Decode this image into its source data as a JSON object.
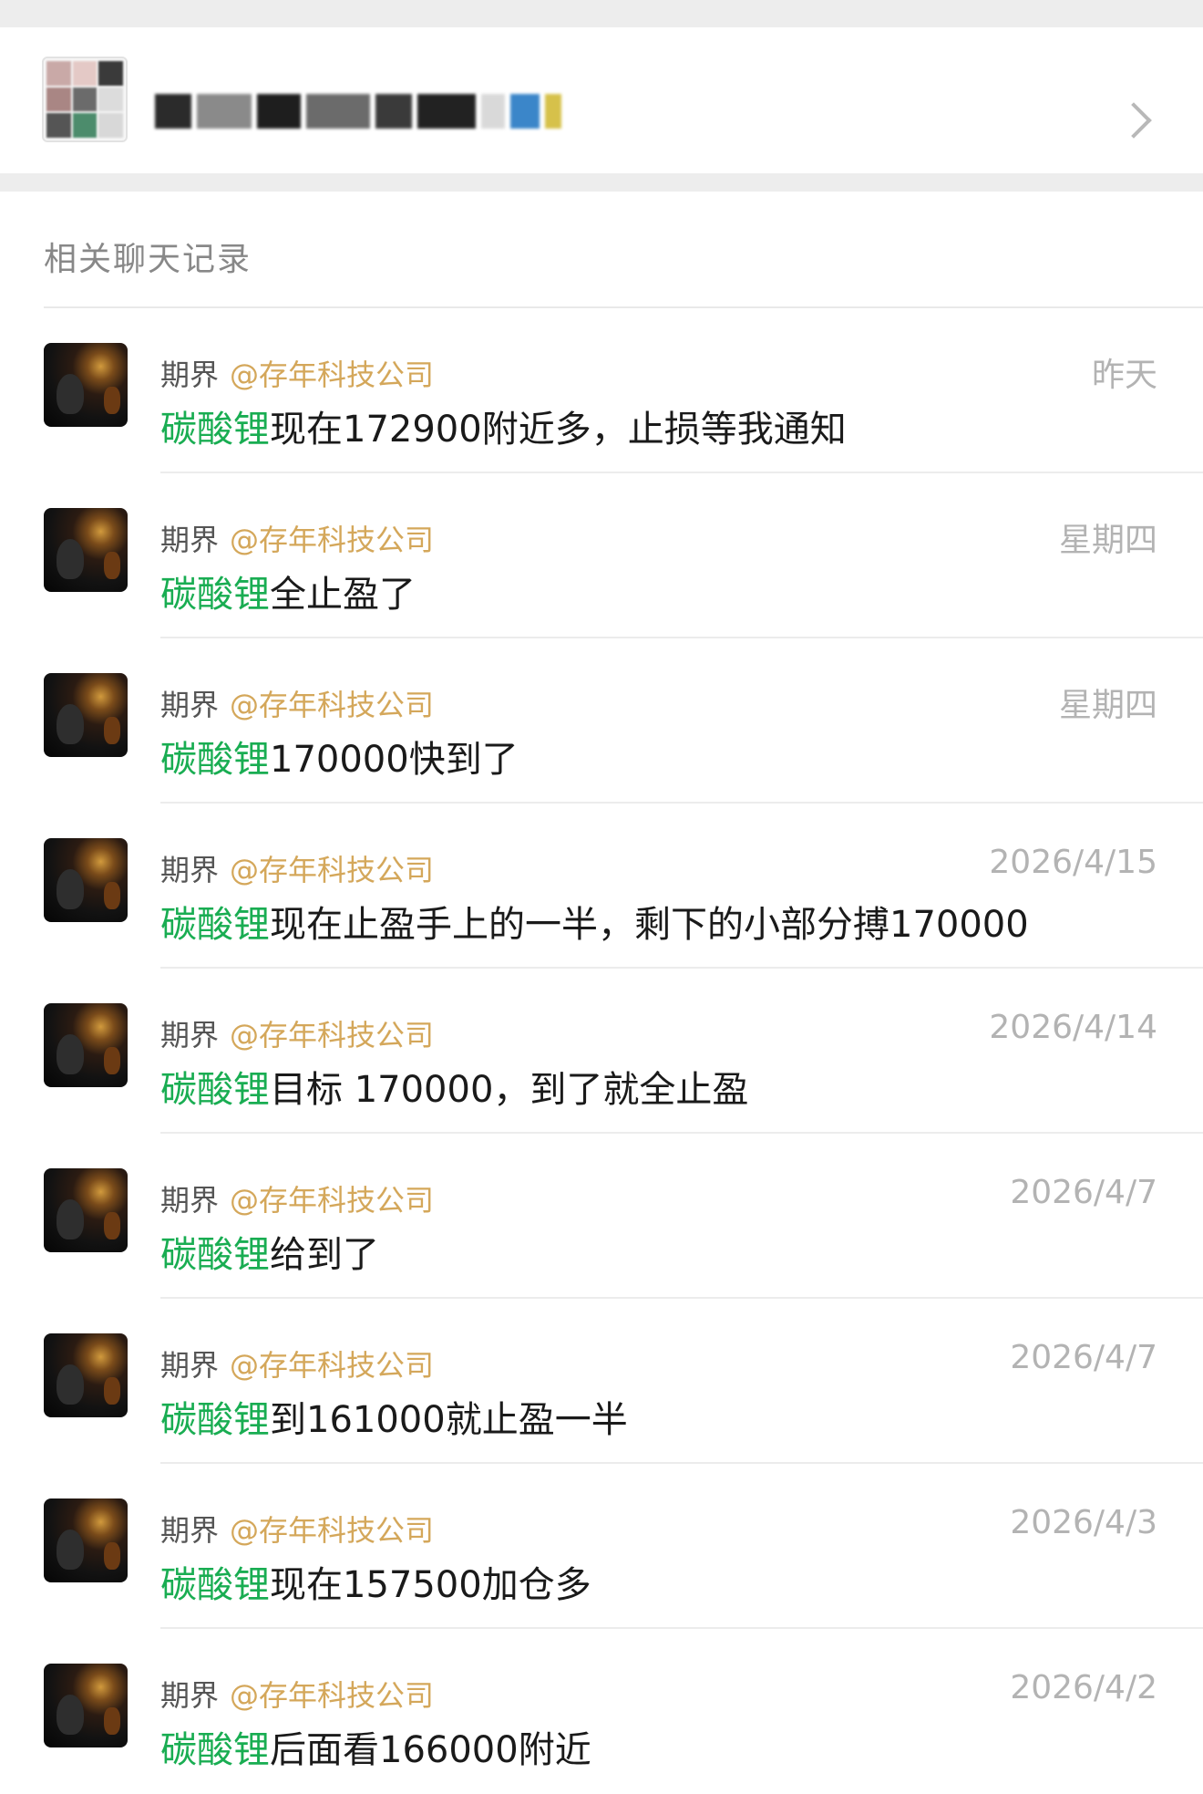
{
  "section": {
    "title": "相关聊天记录"
  },
  "colors": {
    "keyword": "#19ad52",
    "mention": "#d4a75a",
    "timestamp": "#b3b3b3"
  },
  "icons": {
    "group_avatar": "blurred-group-avatar",
    "chevron": "chevron-right-icon",
    "sender_avatar": "sender-avatar"
  },
  "records": [
    {
      "sender": "期界",
      "mention": "@存年科技公司",
      "time": "昨天",
      "keyword": "碳酸锂",
      "text": "现在172900附近多，止损等我通知"
    },
    {
      "sender": "期界",
      "mention": "@存年科技公司",
      "time": "星期四",
      "keyword": "碳酸锂",
      "text": "全止盈了"
    },
    {
      "sender": "期界",
      "mention": "@存年科技公司",
      "time": "星期四",
      "keyword": "碳酸锂",
      "text": "170000快到了"
    },
    {
      "sender": "期界",
      "mention": "@存年科技公司",
      "time": "2026/4/15",
      "keyword": "碳酸锂",
      "text": "现在止盈手上的一半，剩下的小部分搏170000"
    },
    {
      "sender": "期界",
      "mention": "@存年科技公司",
      "time": "2026/4/14",
      "keyword": "碳酸锂",
      "text": "目标 170000，到了就全止盈"
    },
    {
      "sender": "期界",
      "mention": "@存年科技公司",
      "time": "2026/4/7",
      "keyword": "碳酸锂",
      "text": "给到了"
    },
    {
      "sender": "期界",
      "mention": "@存年科技公司",
      "time": "2026/4/7",
      "keyword": "碳酸锂",
      "text": "到161000就止盈一半"
    },
    {
      "sender": "期界",
      "mention": "@存年科技公司",
      "time": "2026/4/3",
      "keyword": "碳酸锂",
      "text": "现在157500加仓多"
    },
    {
      "sender": "期界",
      "mention": "@存年科技公司",
      "time": "2026/4/2",
      "keyword": "碳酸锂",
      "text": "后面看166000附近"
    }
  ]
}
